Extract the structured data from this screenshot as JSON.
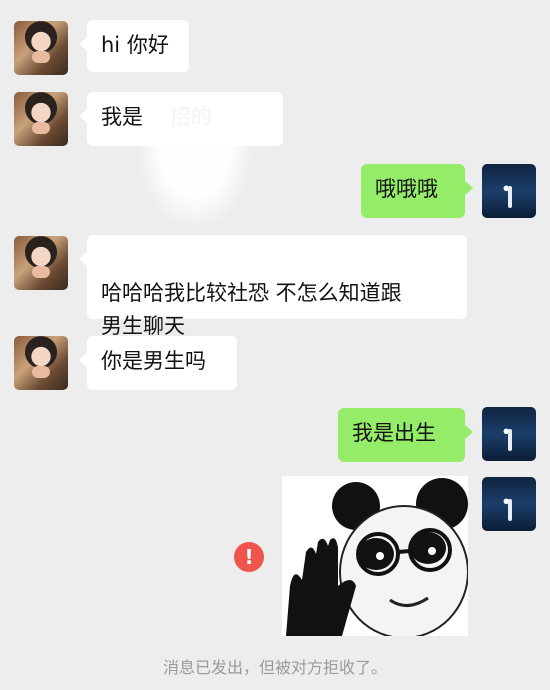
{
  "messages": [
    {
      "side": "left",
      "text": "hi 你好"
    },
    {
      "side": "left",
      "text": "我是    招的"
    },
    {
      "side": "right",
      "text": "哦哦哦"
    },
    {
      "side": "left",
      "text": "哈哈哈我比较社恐  不怎么知道跟\n男生聊天"
    },
    {
      "side": "left",
      "text": "你是男生吗"
    },
    {
      "side": "right",
      "text": "我是出生"
    }
  ],
  "sticker": {
    "icon": "panda-meme-sticker-image"
  },
  "error": {
    "symbol": "!"
  },
  "system_note": "消息已发出，但被对方拒收了。",
  "colors": {
    "background": "#ededed",
    "left_bubble": "#ffffff",
    "right_bubble": "#95ec69",
    "error": "#f0554d",
    "system_text": "#9a9a9a"
  }
}
